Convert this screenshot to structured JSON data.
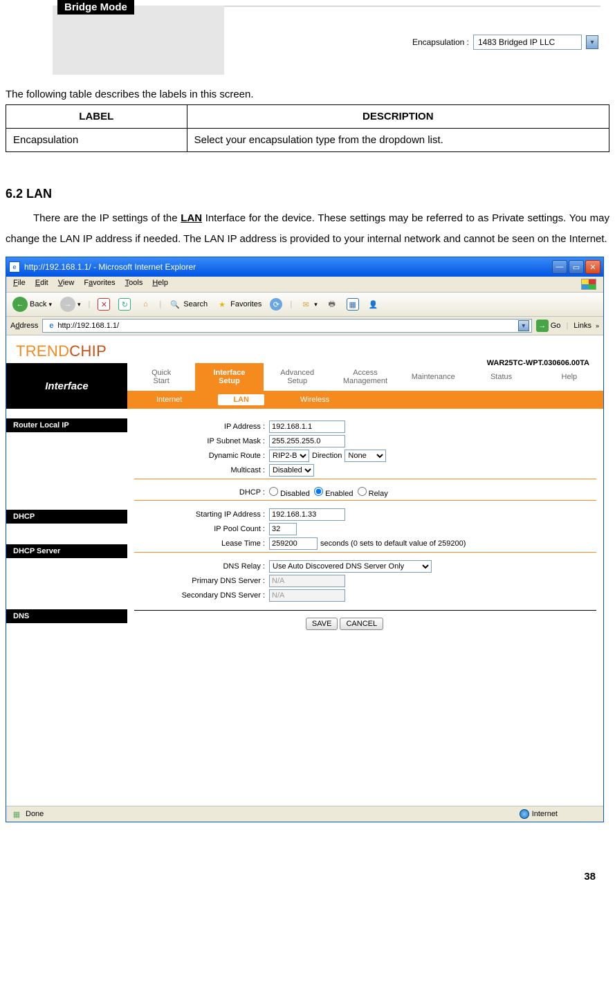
{
  "bridge": {
    "title": "Bridge Mode",
    "encap_label": "Encapsulation :",
    "encap_value": "1483 Bridged IP LLC"
  },
  "intro1": "The following table describes the labels in this screen.",
  "table1": {
    "h1": "LABEL",
    "h2": "DESCRIPTION",
    "r1c1": "Encapsulation",
    "r1c2": "Select your encapsulation type from the dropdown list."
  },
  "sec62": {
    "heading": "6.2 LAN",
    "para": "There are the IP settings of the LAN Interface for the device. These settings may be referred to as Private settings. You may change the LAN IP address if needed. The LAN IP address is provided to your internal network and cannot be seen on the Internet.",
    "para_pre": "There are the IP settings of the ",
    "para_bold": "LAN",
    "para_post": " Interface for the device. These settings may be referred to as Private settings. You may change the LAN IP address if needed. The LAN IP address is provided to your internal network and cannot be seen on the Internet."
  },
  "ie": {
    "title": "http://192.168.1.1/ - Microsoft Internet Explorer",
    "menu": {
      "file": "File",
      "edit": "Edit",
      "view": "View",
      "fav": "Favorites",
      "tools": "Tools",
      "help": "Help"
    },
    "tb": {
      "back": "Back",
      "search": "Search",
      "fav": "Favorites"
    },
    "addr_label": "Address",
    "url": "http://192.168.1.1/",
    "go": "Go",
    "links": "Links",
    "status": "Done",
    "zone": "Internet"
  },
  "router": {
    "brand1": "TREND",
    "brand2": "CHIP",
    "version": "WAR25TC-WPT.030606.00TA",
    "nav_title": "Interface",
    "tabs": {
      "quick": "Quick\nStart",
      "ifsetup": "Interface\nSetup",
      "adv": "Advanced\nSetup",
      "access": "Access\nManagement",
      "maint": "Maintenance",
      "status": "Status",
      "help": "Help"
    },
    "subtabs": {
      "internet": "Internet",
      "lan": "LAN",
      "wireless": "Wireless"
    },
    "sidebar": {
      "local": "Router Local IP",
      "dhcp": "DHCP",
      "dhcpserver": "DHCP Server",
      "dns": "DNS"
    },
    "fields": {
      "ip_label": "IP Address :",
      "ip": "192.168.1.1",
      "mask_label": "IP Subnet Mask :",
      "mask": "255.255.255.0",
      "dynr_label": "Dynamic Route :",
      "dynr": "RIP2-B",
      "dir_label": "Direction",
      "dir": "None",
      "mcast_label": "Multicast :",
      "mcast": "Disabled",
      "dhcp_label": "DHCP :",
      "dhcp_disabled": "Disabled",
      "dhcp_enabled": "Enabled",
      "dhcp_relay": "Relay",
      "startip_label": "Starting IP Address :",
      "startip": "192.168.1.33",
      "pool_label": "IP Pool Count :",
      "pool": "32",
      "lease_label": "Lease Time :",
      "lease": "259200",
      "lease_note": "seconds   (0 sets to default value of 259200)",
      "dnsrelay_label": "DNS Relay :",
      "dnsrelay": "Use Auto Discovered DNS Server Only",
      "pdns_label": "Primary DNS Server :",
      "pdns": "N/A",
      "sdns_label": "Secondary DNS Server :",
      "sdns": "N/A",
      "save": "SAVE",
      "cancel": "CANCEL"
    }
  },
  "page_num": "38"
}
